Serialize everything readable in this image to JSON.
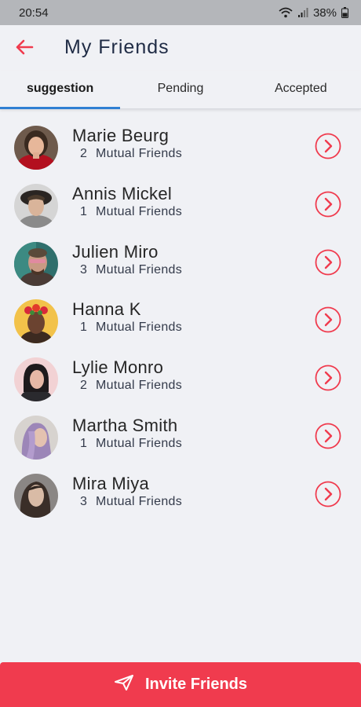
{
  "status_bar": {
    "time": "20:54",
    "battery": "38%"
  },
  "header": {
    "title": "My Friends"
  },
  "tabs": [
    {
      "label": "suggestion",
      "active": true
    },
    {
      "label": "Pending",
      "active": false
    },
    {
      "label": "Accepted",
      "active": false
    }
  ],
  "friends": [
    {
      "name": "Marie Beurg",
      "mutual_count": "2",
      "mutual_label": "Mutual Friends"
    },
    {
      "name": "Annis Mickel",
      "mutual_count": "1",
      "mutual_label": "Mutual Friends"
    },
    {
      "name": "Julien Miro",
      "mutual_count": "3",
      "mutual_label": "Mutual Friends"
    },
    {
      "name": "Hanna K",
      "mutual_count": "1",
      "mutual_label": "Mutual Friends"
    },
    {
      "name": "Lylie Monro",
      "mutual_count": "2",
      "mutual_label": "Mutual Friends"
    },
    {
      "name": "Martha Smith",
      "mutual_count": "1",
      "mutual_label": "Mutual Friends"
    },
    {
      "name": "Mira Miya",
      "mutual_count": "3",
      "mutual_label": "Mutual Friends"
    }
  ],
  "invite_button": {
    "label": "Invite Friends"
  },
  "colors": {
    "accent": "#f03b4e",
    "tab_indicator": "#2f7fd3",
    "title": "#1f2b45"
  }
}
